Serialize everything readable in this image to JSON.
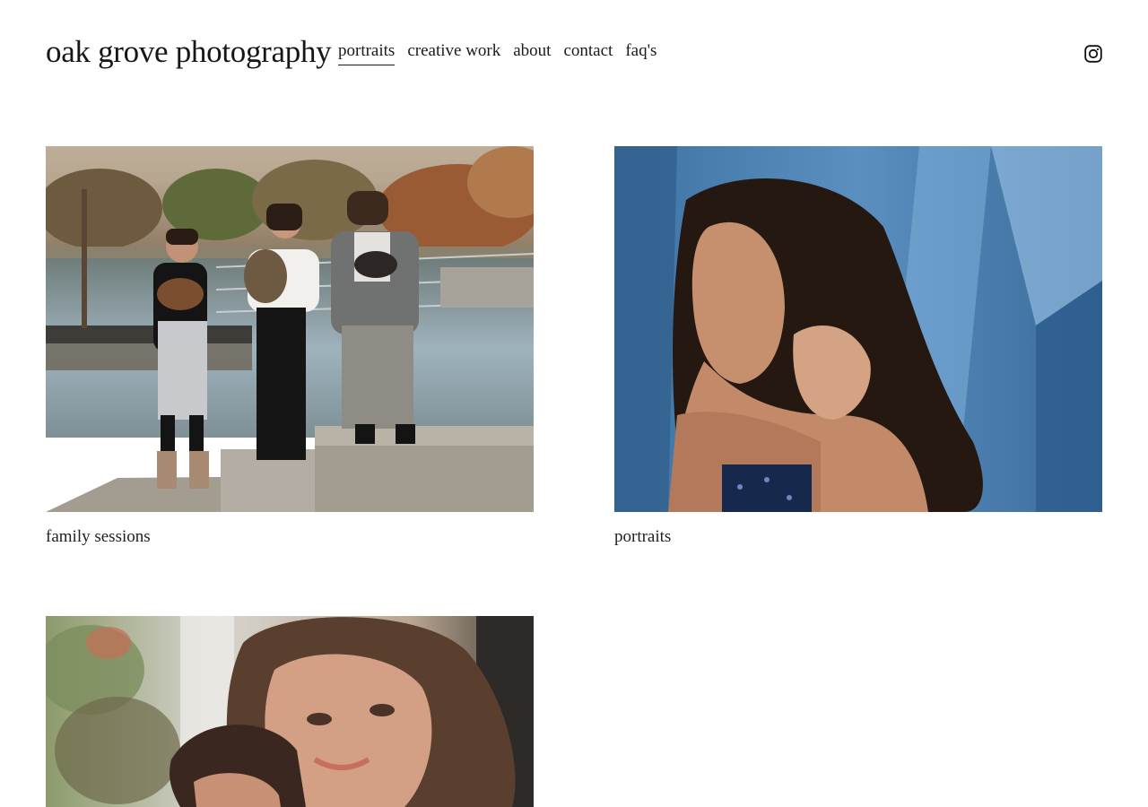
{
  "site": {
    "title": "oak grove photography"
  },
  "nav": {
    "items": [
      {
        "label": "portraits",
        "active": true
      },
      {
        "label": "creative work",
        "active": false
      },
      {
        "label": "about",
        "active": false
      },
      {
        "label": "contact",
        "active": false
      },
      {
        "label": "faq's",
        "active": false
      }
    ]
  },
  "social": {
    "icon": "instagram-icon"
  },
  "gallery": {
    "items": [
      {
        "caption": "family sessions"
      },
      {
        "caption": "portraits"
      },
      {
        "caption": ""
      }
    ]
  }
}
